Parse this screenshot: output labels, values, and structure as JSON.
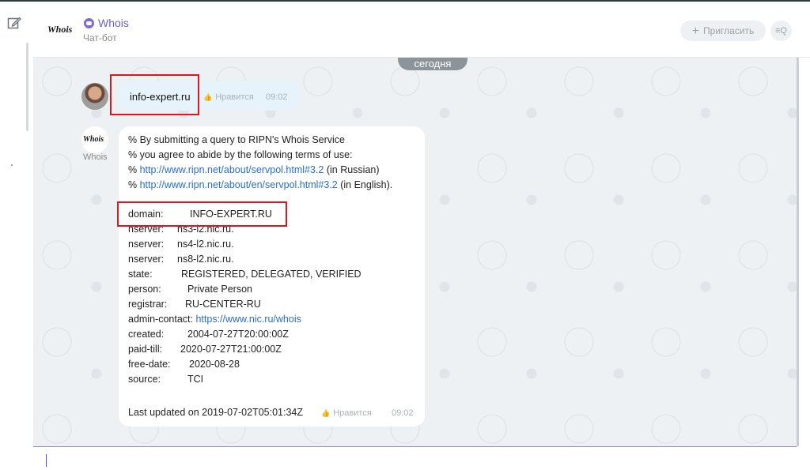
{
  "header": {
    "logo_text": "Whois",
    "title": "Whois",
    "subtitle": "Чат-бот",
    "invite_label": "Пригласить",
    "search_icon_label": "≡Q"
  },
  "chat": {
    "date_label": "сегодня",
    "user_message": {
      "text": "info-expert.ru",
      "like_label": "Нравится",
      "time": "09:02"
    },
    "bot": {
      "avatar_text": "Whois",
      "name": "Whois",
      "intro": [
        "% By submitting a query to RIPN's Whois Service",
        "% you agree to abide by the following terms of use:"
      ],
      "link1_prefix": "% ",
      "link1": "http://www.ripn.net/about/servpol.html#3.2",
      "link1_suffix": " (in Russian)",
      "link2_prefix": "% ",
      "link2": "http://www.ripn.net/about/en/servpol.html#3.2",
      "link2_suffix": " (in English).",
      "domain_key": "domain:",
      "domain_value": "INFO-EXPERT.RU",
      "nserver_key": "nserver:",
      "nservers": [
        "ns3-l2.nic.ru.",
        "ns4-l2.nic.ru.",
        "ns8-l2.nic.ru."
      ],
      "state_key": "state:",
      "state_value": "REGISTERED, DELEGATED, VERIFIED",
      "person_key": "person:",
      "person_value": "Private Person",
      "registrar_key": "registrar:",
      "registrar_value": "RU-CENTER-RU",
      "admin_key": "admin-contact:",
      "admin_link": "https://www.nic.ru/whois",
      "created_key": "created:",
      "created_value": "2004-07-27T20:00:00Z",
      "paid_key": "paid-till:",
      "paid_value": "2020-07-27T21:00:00Z",
      "free_key": "free-date:",
      "free_value": "2020-08-28",
      "source_key": "source:",
      "source_value": "TCI",
      "last_updated": "Last updated on 2019-07-02T05:01:34Z",
      "like_label": "Нравится",
      "time": "09:02"
    }
  },
  "colors": {
    "accent": "#6d5fd0",
    "link": "#2a6fc5",
    "highlight": "#d9191f"
  }
}
